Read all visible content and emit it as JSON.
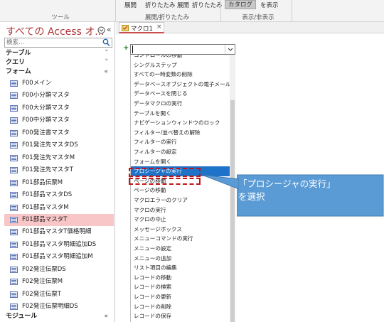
{
  "ribbon": {
    "groups": [
      {
        "title": "ツール"
      },
      {
        "title": "展開/折りたたみ"
      },
      {
        "title": "表示/非表示"
      }
    ],
    "buttons": [
      "展開",
      "折りたたみ",
      "展開",
      "折りたたみ",
      "カタログ",
      "を表示"
    ]
  },
  "nav": {
    "title": "すべての Access オ...",
    "search_placeholder": "検索...",
    "categories": {
      "table": "テーブル",
      "query": "クエリ",
      "form": "フォーム",
      "module": "モジュール"
    },
    "forms": [
      "F00メイン",
      "F00小分類マスタ",
      "F00大分類マスタ",
      "F00中分類マスタ",
      "F00発注書マスタ",
      "F01発注先マスタDS",
      "F01発注先マスタM",
      "F01発注先マスタT",
      "F01部品伝票M",
      "F01部品マスタDS",
      "F01部品マスタM",
      "F01部品マスタT",
      "F01部品マスタT価格明細",
      "F01部品マスタ明細追加DS",
      "F01部品マスタ明細追加M",
      "F02発注伝票DS",
      "F02発注伝票M",
      "F02発注伝票T",
      "F02発注伝票明細DS"
    ],
    "selected_form": "F01部品マスタT"
  },
  "document": {
    "tab_label": "マクロ1",
    "close_glyph": "×",
    "plus_glyph": "+",
    "dropdown_arrow": "⌄",
    "actions": [
      "コントロールの移動",
      "シングルステップ",
      "すべての一時変数の削除",
      "データベースオブジェクトの電子メール送信",
      "データベースを閉じる",
      "データマクロの実行",
      "テーブルを開く",
      "ナビゲーションウィンドウのロック",
      "フィルター/並べ替えの解除",
      "フィルターの実行",
      "フィルターの設定",
      "フォームを開く",
      "プロシージャの実行",
      "ページの移動",
      "ページの移動",
      "マクロエラーのクリア",
      "マクロの実行",
      "マクロの中止",
      "メッセージボックス",
      "メニューコマンドの実行",
      "メニューの設定",
      "メニューの追加",
      "リスト項目の編集",
      "レコードの移動",
      "レコードの検索",
      "レコードの更新",
      "レコードの削除",
      "レコードの保存"
    ],
    "highlighted_action": "プロシージャの実行"
  },
  "callout": {
    "line1": "「プロシージャの実行」",
    "line2": "を選択"
  },
  "colors": {
    "title_red": "#b0363a",
    "highlight_blue": "#1e72c7",
    "selected_pink": "#f8c6c7",
    "annotation_red": "#c0161b",
    "callout_blue": "#5b9bd5"
  }
}
